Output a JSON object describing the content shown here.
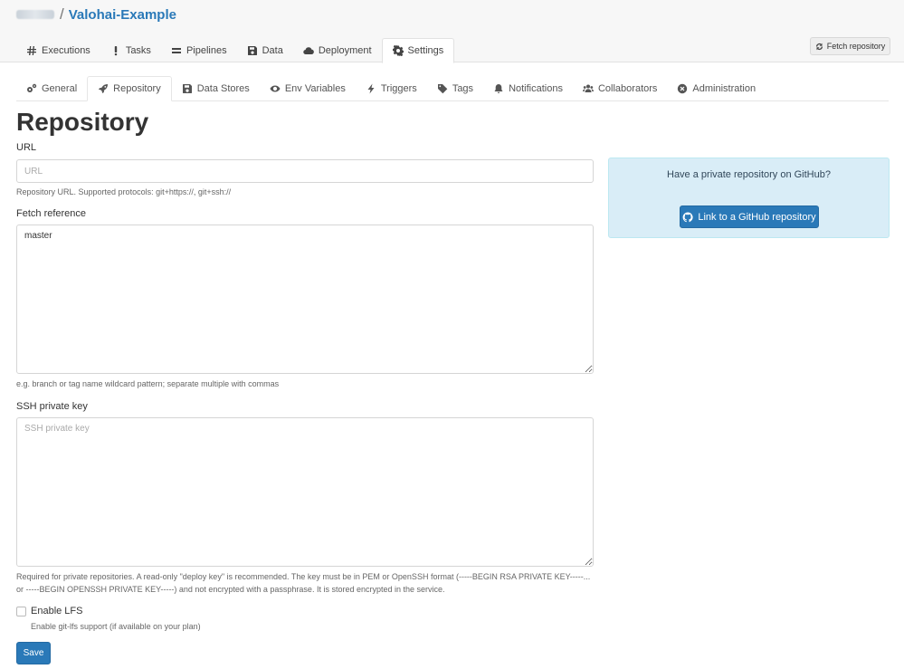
{
  "breadcrumb": {
    "separator": "/",
    "project": "Valohai-Example"
  },
  "main_tabs": [
    {
      "label": "Executions",
      "icon": "hash-icon"
    },
    {
      "label": "Tasks",
      "icon": "exclamation-icon"
    },
    {
      "label": "Pipelines",
      "icon": "bars-icon"
    },
    {
      "label": "Data",
      "icon": "floppy-icon"
    },
    {
      "label": "Deployment",
      "icon": "cloud-icon"
    },
    {
      "label": "Settings",
      "icon": "gear-icon",
      "active": true
    }
  ],
  "fetch_button": {
    "label": "Fetch repository",
    "icon": "refresh-icon"
  },
  "sub_tabs": [
    {
      "label": "General",
      "icon": "gears-icon"
    },
    {
      "label": "Repository",
      "icon": "rocket-icon",
      "active": true
    },
    {
      "label": "Data Stores",
      "icon": "floppy-icon"
    },
    {
      "label": "Env Variables",
      "icon": "eye-icon"
    },
    {
      "label": "Triggers",
      "icon": "bolt-icon"
    },
    {
      "label": "Tags",
      "icon": "tag-icon"
    },
    {
      "label": "Notifications",
      "icon": "bell-icon"
    },
    {
      "label": "Collaborators",
      "icon": "users-icon"
    },
    {
      "label": "Administration",
      "icon": "times-circle-icon"
    }
  ],
  "page_title": "Repository",
  "form": {
    "url": {
      "label": "URL",
      "placeholder": "URL",
      "value": "",
      "help": "Repository URL. Supported protocols: git+https://, git+ssh://"
    },
    "fetch_reference": {
      "label": "Fetch reference",
      "value": "master",
      "help": "e.g. branch or tag name wildcard pattern; separate multiple with commas"
    },
    "ssh_key": {
      "label": "SSH private key",
      "placeholder": "SSH private key",
      "value": "",
      "help_line1": "Required for private repositories. A read-only \"deploy key\" is recommended. The key must be in PEM or OpenSSH format (-----BEGIN RSA PRIVATE KEY-----...",
      "help_line2": "or -----BEGIN OPENSSH PRIVATE KEY-----) and not encrypted with a passphrase. It is stored encrypted in the service."
    },
    "lfs": {
      "label": "Enable LFS",
      "help": "Enable git-lfs support (if available on your plan)",
      "checked": false
    },
    "save_label": "Save"
  },
  "github_panel": {
    "text": "Have a private repository on GitHub?",
    "button_label": "Link to a GitHub repository",
    "button_icon": "github-icon"
  },
  "colors": {
    "primary": "#2a79b8",
    "info_panel": "#d9edf7"
  }
}
